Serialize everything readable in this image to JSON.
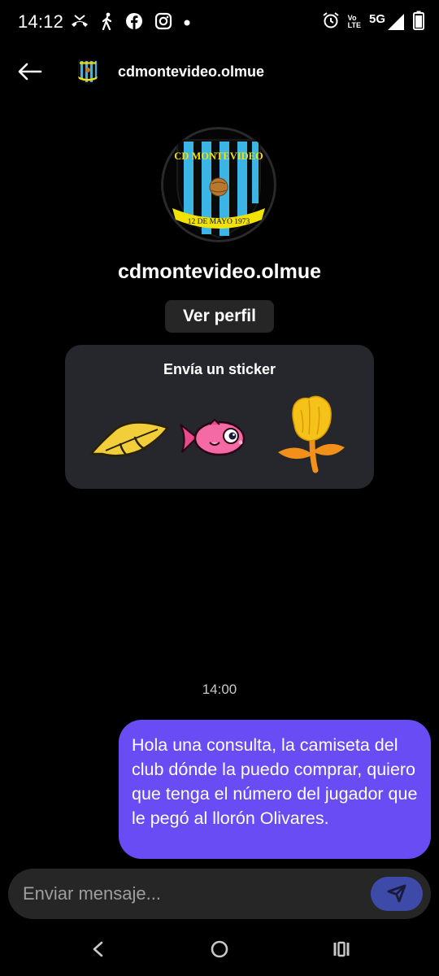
{
  "status_bar": {
    "time": "14:12",
    "network": "5G",
    "volte_top": "Vo",
    "volte_bottom": "LTE",
    "left_icons": [
      "missed-call-icon",
      "walking-icon",
      "facebook-icon",
      "instagram-icon",
      "dot-icon"
    ],
    "right_icons": [
      "alarm-icon",
      "volte-icon",
      "signal-icon",
      "battery-icon"
    ]
  },
  "header": {
    "title": "cdmontevideo.olmue",
    "back_icon": "back-arrow-icon"
  },
  "profile": {
    "name": "cdmontevideo.olmue",
    "view_profile_label": "Ver perfil",
    "logo_top_text": "CD MONTEVIDEO",
    "logo_ribbon_text": "12 DE MAYO 1973"
  },
  "sticker_prompt": {
    "title": "Envía un sticker",
    "stickers": [
      "leaf-sticker",
      "fish-sticker",
      "flower-sticker"
    ]
  },
  "chat": {
    "timestamp": "14:00",
    "messages": [
      {
        "sender": "me",
        "text": "Hola una consulta, la camiseta del club dónde la puedo comprar, quiero que tenga el número del jugador que le pegó al llorón Olivares."
      }
    ]
  },
  "composer": {
    "placeholder": "Enviar mensaje...",
    "send_icon": "send-icon"
  },
  "colors": {
    "background": "#000000",
    "bubble": "#6a4cf5",
    "card": "#25272c",
    "send_button": "#3d4aa8",
    "input": "#262626"
  }
}
